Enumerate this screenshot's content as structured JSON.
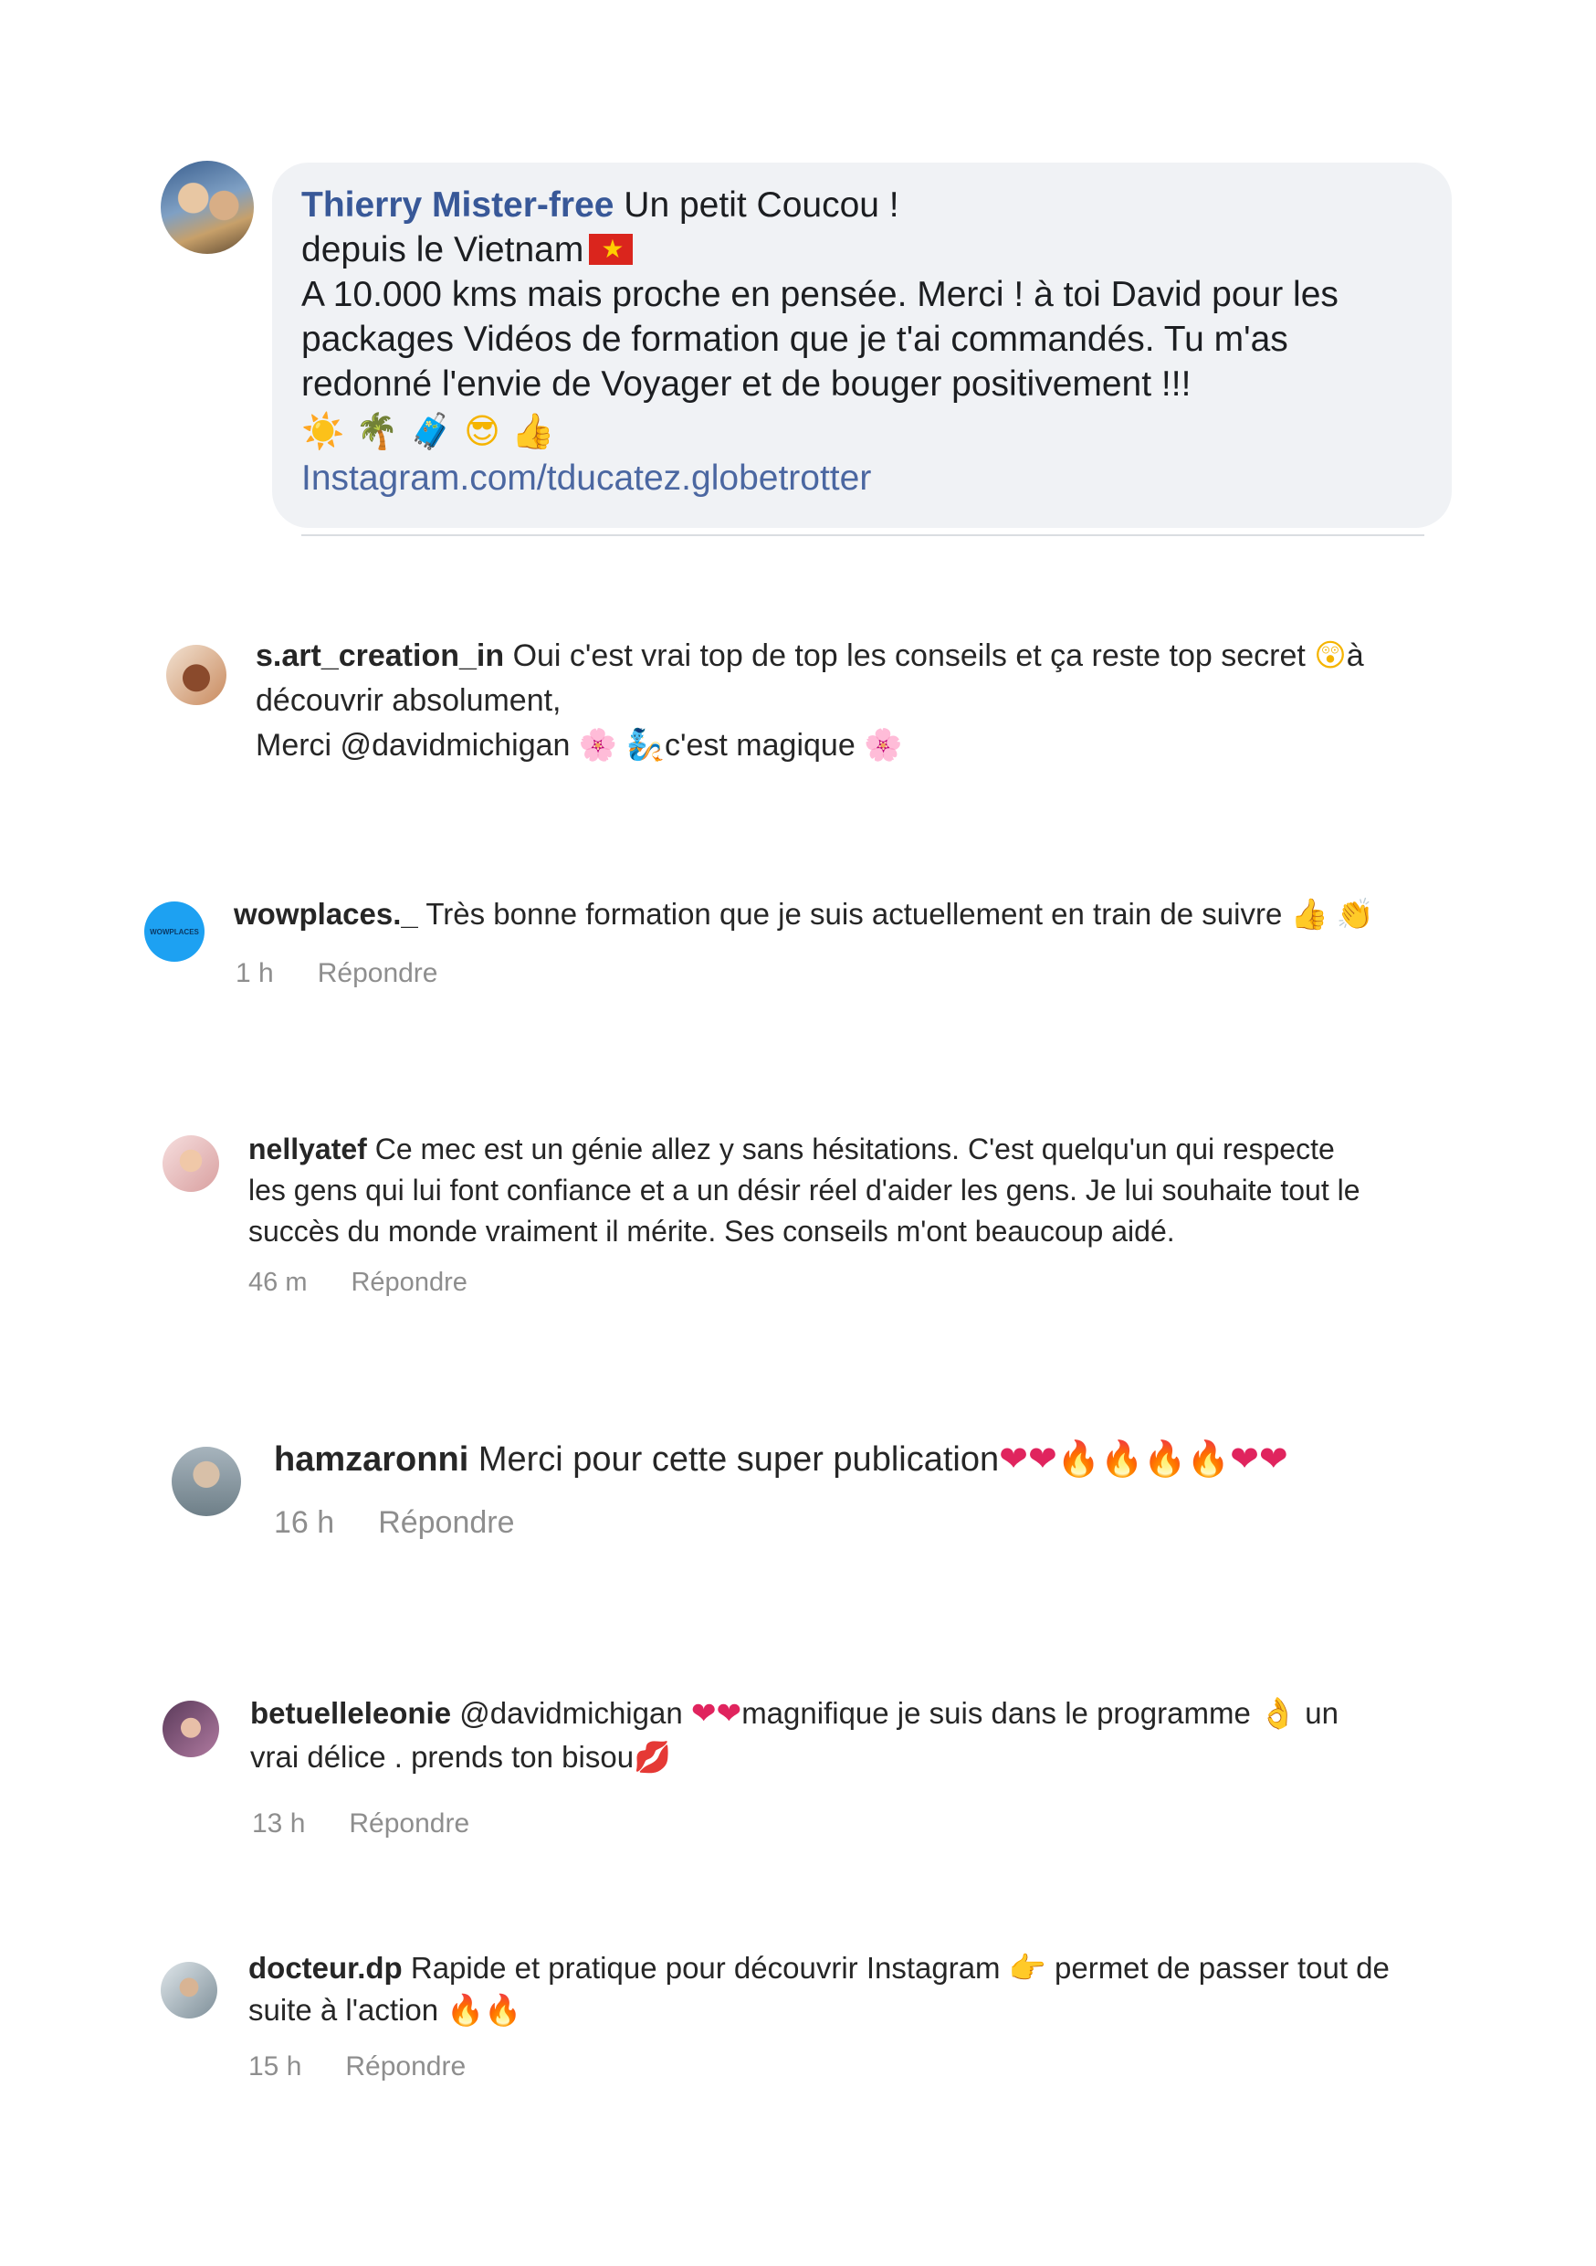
{
  "comments": [
    {
      "platform": "facebook",
      "username": "Thierry Mister-free",
      "lines": [
        "Un petit Coucou !",
        "depuis le Vietnam",
        "A 10.000 kms mais proche en pensée. Merci ! à toi David pour les",
        "packages Vidéos de formation que je t'ai commandés. Tu m'as",
        "redonné l'envie de Voyager et de bouger positivement !!!"
      ],
      "emojis": [
        "☀️",
        "🌴",
        "🧳",
        "😎",
        "👍"
      ],
      "link": "Instagram.com/tducatez.globetrotter"
    },
    {
      "platform": "instagram",
      "username": "s.art_creation_in",
      "text_1": "Oui c'est vrai top de top les conseils et ça reste top secret",
      "text_1b": "à",
      "text_2": "découvrir absolument,",
      "text_3a": "Merci @davidmichigan",
      "text_3b": "c'est magique"
    },
    {
      "platform": "instagram",
      "username": "wowplaces._",
      "avatar_label": "WOWPLACES",
      "text": "Très bonne formation que je suis actuellement en train de suivre",
      "time": "1 h",
      "reply": "Répondre"
    },
    {
      "platform": "instagram",
      "username": "nellyatef",
      "text_1": "Ce mec est un génie allez y sans hésitations. C'est quelqu'un qui respecte",
      "text_2": "les gens qui lui font confiance et a un désir réel d'aider les gens. Je lui souhaite tout le",
      "text_3": "succès du monde vraiment il mérite. Ses conseils m'ont beaucoup aidé.",
      "time": "46 m",
      "reply": "Répondre"
    },
    {
      "platform": "instagram",
      "username": "hamzaronni",
      "text": "Merci pour cette super publication",
      "time": "16 h",
      "reply": "Répondre"
    },
    {
      "platform": "instagram",
      "username": "betuelleleonie",
      "text_1a": "@davidmichigan",
      "text_1b": "magnifique je suis dans le programme",
      "text_1c": "un",
      "text_2": "vrai délice . prends ton bisou",
      "time": "13 h",
      "reply": "Répondre"
    },
    {
      "platform": "instagram",
      "username": "docteur.dp",
      "text_1a": "Rapide et pratique pour découvrir Instagram",
      "text_1b": "permet de passer tout de",
      "text_2": "suite à l'action",
      "time": "15 h",
      "reply": "Répondre"
    }
  ],
  "colors": {
    "facebook_name": "#385898",
    "facebook_bubble": "#f0f2f5",
    "meta_gray": "#8e8e8e",
    "wowplaces_avatar": "#1da1f2"
  }
}
